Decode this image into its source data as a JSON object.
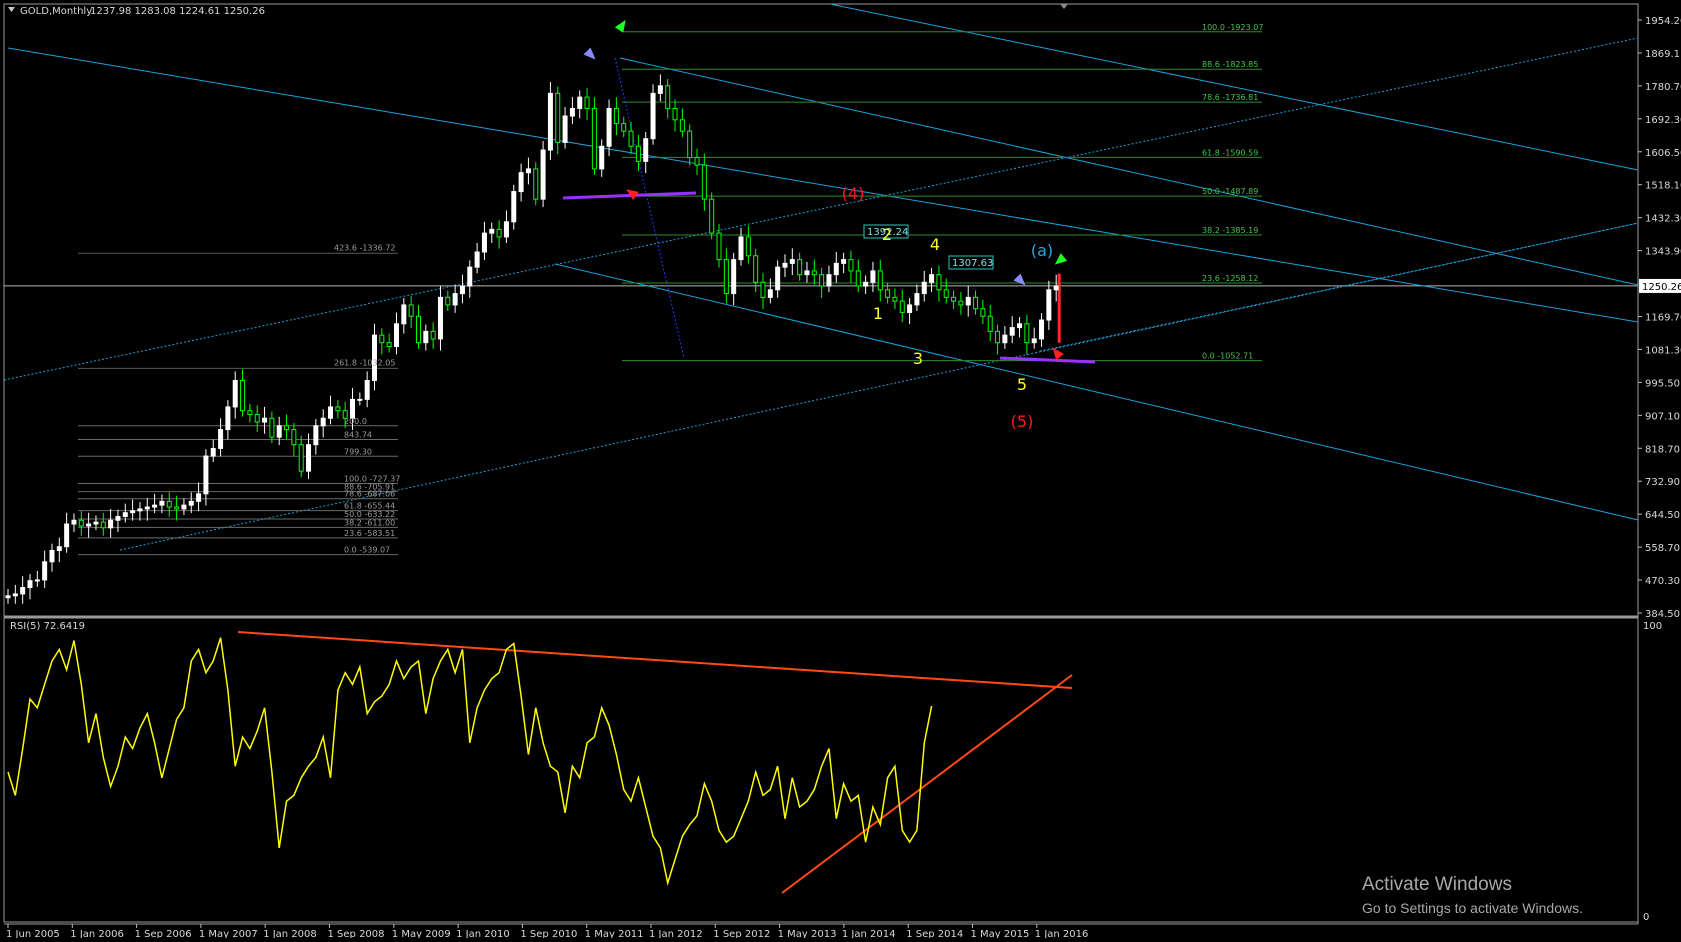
{
  "header": {
    "symbol_title": "GOLD,Monthly",
    "ohlc": "1237.98 1283.08 1224.61 1250.26"
  },
  "rsi": {
    "title": "RSI(5) 72.6419",
    "axis_top": "100",
    "axis_bottom": "0"
  },
  "watermark": {
    "title": "Activate Windows",
    "subtitle": "Go to Settings to activate Windows."
  },
  "colors": {
    "background": "#000000",
    "bull_candle": "#ffffff",
    "bear_candle": "#00ff00",
    "channel": "#1ea0dc",
    "fib_line": "#2e8b2e",
    "fib_text": "#4fbf4f",
    "grey_fib": "#9a9a9a",
    "rsi_line": "#ffff00",
    "trendline": "#ff4a14",
    "wave_yellow": "#ffff2a",
    "wave_red": "#ff1a1a",
    "wave_blue": "#28a8e8",
    "purple": "#9b30ff"
  },
  "icons": [
    "green-arrow-icon",
    "blue-arrow-icon",
    "red-arrow-icon",
    "dropdown-triangle-icon"
  ],
  "chart_data": [
    {
      "type": "candlestick",
      "title": "GOLD,Monthly",
      "y_tick_labels": [
        "1954.20",
        "1869.11",
        "1780.70",
        "1692.30",
        "1606.50",
        "1518.10",
        "1432.30",
        "1343.90",
        "1250.26",
        "1169.70",
        "1081.30",
        "995.50",
        "907.10",
        "818.70",
        "732.90",
        "644.50",
        "558.70",
        "470.30",
        "384.50"
      ],
      "x_tick_labels": [
        "1 Jun 2005",
        "1 Jan 2006",
        "1 Sep 2006",
        "1 May 2007",
        "1 Jan 2008",
        "1 Sep 2008",
        "1 May 2009",
        "1 Jan 2010",
        "1 Sep 2010",
        "1 May 2011",
        "1 Jan 2012",
        "1 Sep 2012",
        "1 May 2013",
        "1 Jan 2014",
        "1 Sep 2014",
        "1 May 2015",
        "1 Jan 2016"
      ],
      "ylim": [
        384.5,
        1954.2
      ],
      "current_price": "1250.26",
      "closes": [
        430,
        435,
        452,
        470,
        472,
        520,
        550,
        560,
        620,
        630,
        615,
        620,
        625,
        610,
        630,
        640,
        650,
        655,
        660,
        665,
        670,
        680,
        665,
        660,
        670,
        680,
        700,
        800,
        820,
        870,
        930,
        1000,
        920,
        910,
        890,
        900,
        850,
        880,
        870,
        830,
        760,
        830,
        880,
        900,
        930,
        920,
        900,
        950,
        950,
        1000,
        1120,
        1100,
        1090,
        1150,
        1200,
        1170,
        1100,
        1130,
        1110,
        1220,
        1200,
        1230,
        1250,
        1300,
        1340,
        1390,
        1400,
        1380,
        1420,
        1500,
        1550,
        1560,
        1480,
        1610,
        1760,
        1630,
        1700,
        1720,
        1750,
        1720,
        1560,
        1620,
        1720,
        1680,
        1660,
        1620,
        1580,
        1640,
        1760,
        1780,
        1720,
        1690,
        1660,
        1590,
        1570,
        1480,
        1390,
        1320,
        1230,
        1320,
        1380,
        1330,
        1260,
        1220,
        1240,
        1300,
        1310,
        1320,
        1280,
        1290,
        1280,
        1250,
        1280,
        1310,
        1320,
        1290,
        1250,
        1260,
        1290,
        1240,
        1220,
        1210,
        1180,
        1200,
        1230,
        1260,
        1280,
        1240,
        1220,
        1210,
        1200,
        1220,
        1190,
        1170,
        1130,
        1100,
        1120,
        1140,
        1150,
        1100,
        1110,
        1160,
        1240,
        1250
      ],
      "levels": [
        {
          "label": "100.0 -1923.07",
          "price": 1923.07
        },
        {
          "label": "88.6 -1823.85",
          "price": 1823.85
        },
        {
          "label": "78.6 -1736.81",
          "price": 1736.81
        },
        {
          "label": "61.8 -1590.59",
          "price": 1590.59
        },
        {
          "label": "50.0 -1487.89",
          "price": 1487.89
        },
        {
          "label": "38.2 -1385.19",
          "price": 1385.19
        },
        {
          "label": "23.6 -1258.12",
          "price": 1258.12
        },
        {
          "label": "0.0 -1052.71",
          "price": 1052.71
        },
        {
          "label": "423.6 -1336.72",
          "price": 1336.72
        },
        {
          "label": "261.8 -1032.05",
          "price": 1032.05
        },
        {
          "label": "0.0 -539.07",
          "price": 539.07
        },
        {
          "label": "23.6 -583.51",
          "price": 583.51
        },
        {
          "label": "38.2 -611.00",
          "price": 611.0
        },
        {
          "label": "50.0 -633.22",
          "price": 633.22
        },
        {
          "label": "61.8 -655.44",
          "price": 655.44
        },
        {
          "label": "78.6 -687.06",
          "price": 687.06
        },
        {
          "label": "88.6 -705.91",
          "price": 705.91
        },
        {
          "label": "100.0 -727.37",
          "price": 727.37
        },
        {
          "label": "799.30",
          "price": 799.3
        },
        {
          "label": "843.74",
          "price": 843.74
        },
        {
          "label": "200.0",
          "price": 880.0
        }
      ],
      "price_labels": [
        "1307.63",
        "1392.24"
      ],
      "wave_labels": [
        {
          "text": "(4)",
          "color": "red"
        },
        {
          "text": "(5)",
          "color": "red"
        },
        {
          "text": "(a)",
          "color": "blue"
        },
        {
          "text": "1",
          "color": "yellow"
        },
        {
          "text": "2",
          "color": "yellow"
        },
        {
          "text": "3",
          "color": "yellow"
        },
        {
          "text": "4",
          "color": "yellow"
        },
        {
          "text": "5",
          "color": "yellow"
        }
      ]
    },
    {
      "type": "line",
      "title": "RSI(5) 72.6419",
      "ylim": [
        0,
        100
      ],
      "current_value": 72.6419,
      "values": [
        50,
        42,
        58,
        75,
        72,
        80,
        88,
        92,
        85,
        95,
        80,
        60,
        70,
        55,
        45,
        52,
        62,
        58,
        65,
        70,
        60,
        48,
        58,
        68,
        72,
        88,
        92,
        84,
        88,
        96,
        78,
        52,
        62,
        58,
        64,
        72,
        50,
        24,
        40,
        42,
        48,
        52,
        55,
        62,
        48,
        78,
        84,
        80,
        86,
        70,
        74,
        76,
        80,
        88,
        82,
        86,
        88,
        70,
        82,
        88,
        92,
        84,
        92,
        60,
        72,
        78,
        82,
        84,
        92,
        94,
        76,
        56,
        72,
        60,
        52,
        50,
        36,
        52,
        48,
        60,
        62,
        72,
        66,
        56,
        44,
        40,
        48,
        38,
        28,
        24,
        12,
        20,
        28,
        32,
        35,
        46,
        40,
        30,
        26,
        28,
        34,
        40,
        50,
        42,
        44,
        52,
        34,
        48,
        38,
        40,
        44,
        52,
        58,
        34,
        46,
        40,
        42,
        26,
        38,
        32,
        48,
        52,
        30,
        26,
        30,
        60,
        72.6
      ]
    }
  ]
}
